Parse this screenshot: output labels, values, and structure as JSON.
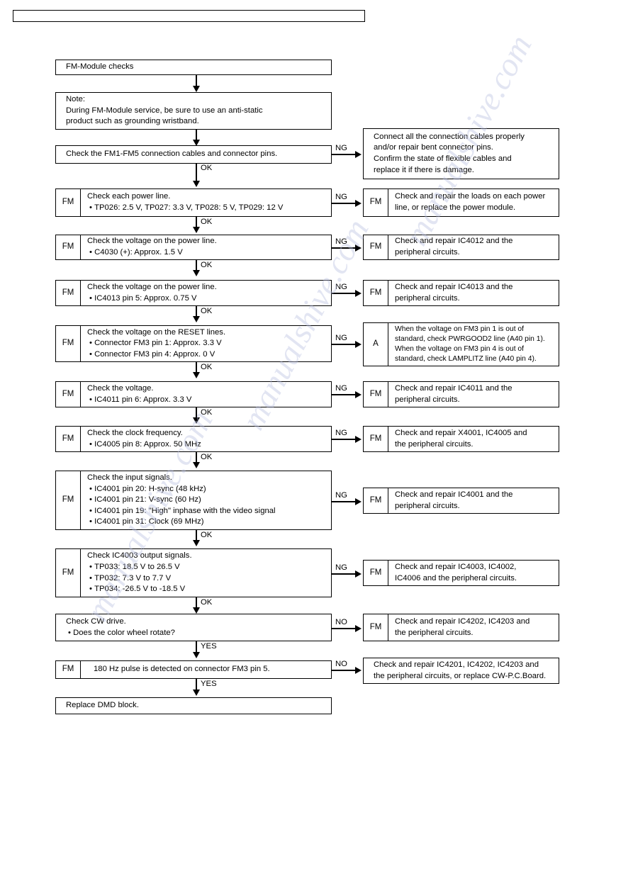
{
  "page": {
    "header_bar_text": "",
    "watermark_text": "manualshive.com"
  },
  "flow": {
    "start": {
      "title": "FM-Module checks"
    },
    "note": {
      "line1": "Note:",
      "line2": "During FM-Module service, be sure to use an anti-static",
      "line3": "product such as grounding wristband."
    },
    "steps": [
      {
        "id": "step-cables",
        "tag": "",
        "lines": [
          "Check the FM1-FM5 connection cables and connector pins."
        ],
        "branch_label": "NG",
        "flow_label": "OK",
        "result": {
          "tag": "",
          "lines": [
            "Connect all the connection cables properly",
            "and/or repair bent connector pins.",
            "Confirm the state of flexible cables and",
            "replace it if there is damage."
          ]
        }
      },
      {
        "id": "step-power-lines",
        "tag": "FM",
        "lines": [
          "Check each power line.",
          "TP026: 2.5 V, TP027: 3.3 V, TP028: 5 V, TP029: 12 V"
        ],
        "branch_label": "NG",
        "flow_label": "OK",
        "result": {
          "tag": "FM",
          "lines": [
            "Check and repair the loads on each power",
            "line, or replace the power module."
          ]
        }
      },
      {
        "id": "step-c4030",
        "tag": "FM",
        "lines": [
          "Check the voltage on the power line.",
          "C4030 (+): Approx. 1.5 V"
        ],
        "branch_label": "NG",
        "flow_label": "OK",
        "result": {
          "tag": "FM",
          "lines": [
            "Check and repair IC4012 and the",
            "peripheral circuits."
          ]
        }
      },
      {
        "id": "step-ic4013",
        "tag": "FM",
        "lines": [
          "Check the voltage on the power line.",
          "IC4013 pin 5: Approx. 0.75 V"
        ],
        "branch_label": "NG",
        "flow_label": "OK",
        "result": {
          "tag": "FM",
          "lines": [
            "Check and repair IC4013 and the",
            "peripheral circuits."
          ]
        }
      },
      {
        "id": "step-reset",
        "tag": "FM",
        "lines": [
          "Check the voltage on the RESET lines.",
          "Connector FM3 pin 1: Approx. 3.3 V",
          "Connector FM3 pin 4: Approx. 0 V"
        ],
        "branch_label": "NG",
        "flow_label": "OK",
        "result": {
          "tag": "A",
          "lines": [
            "When the voltage on FM3 pin 1 is out of",
            "standard, check PWRGOOD2 line (A40 pin 1).",
            "When the voltage on FM3 pin 4 is out of",
            "standard, check LAMPLITZ line (A40 pin 4)."
          ]
        }
      },
      {
        "id": "step-ic4011",
        "tag": "FM",
        "lines": [
          "Check the voltage.",
          "IC4011 pin 6: Approx. 3.3 V"
        ],
        "branch_label": "NG",
        "flow_label": "OK",
        "result": {
          "tag": "FM",
          "lines": [
            "Check and repair IC4011 and the",
            "peripheral circuits."
          ]
        }
      },
      {
        "id": "step-clock",
        "tag": "FM",
        "lines": [
          "Check the clock frequency.",
          "IC4005 pin 8: Approx. 50 MHz"
        ],
        "branch_label": "NG",
        "flow_label": "OK",
        "result": {
          "tag": "FM",
          "lines": [
            "Check and repair X4001, IC4005 and",
            "the peripheral circuits."
          ]
        }
      },
      {
        "id": "step-input-signals",
        "tag": "FM",
        "lines": [
          "Check the input signals.",
          "IC4001 pin 20: H-sync (48 kHz)",
          "IC4001 pin 21: V-sync (60 Hz)",
          "IC4001 pin 19: \"High\" inphase with the video signal",
          "IC4001 pin 31: Clock (69 MHz)"
        ],
        "branch_label": "NG",
        "flow_label": "OK",
        "result": {
          "tag": "FM",
          "lines": [
            "Check and repair IC4001 and the",
            "peripheral circuits."
          ]
        }
      },
      {
        "id": "step-ic4003-output",
        "tag": "FM",
        "lines": [
          "Check IC4003 output signals.",
          "TP033: 18.5 V to 26.5 V",
          "TP032: 7.3 V to 7.7 V",
          "TP034: -26.5 V to -18.5 V"
        ],
        "branch_label": "NG",
        "flow_label": "OK",
        "result": {
          "tag": "FM",
          "lines": [
            "Check and repair IC4003, IC4002,",
            "IC4006 and the peripheral circuits."
          ]
        }
      },
      {
        "id": "step-cw-drive",
        "tag": "",
        "lines": [
          "Check CW drive.",
          "Does the color wheel rotate?"
        ],
        "branch_label": "NO",
        "flow_label": "YES",
        "result": {
          "tag": "FM",
          "lines": [
            "Check and repair IC4202, IC4203 and",
            "the peripheral circuits."
          ]
        }
      },
      {
        "id": "step-180hz",
        "tag": "FM",
        "lines": [
          "180 Hz pulse is detected on connector FM3 pin 5."
        ],
        "branch_label": "NO",
        "flow_label": "YES",
        "result": {
          "tag": "",
          "lines": [
            "Check and repair IC4201, IC4202, IC4203 and",
            "the peripheral circuits, or replace CW-P.C.Board."
          ]
        }
      }
    ],
    "end": {
      "title": "Replace DMD block."
    }
  }
}
